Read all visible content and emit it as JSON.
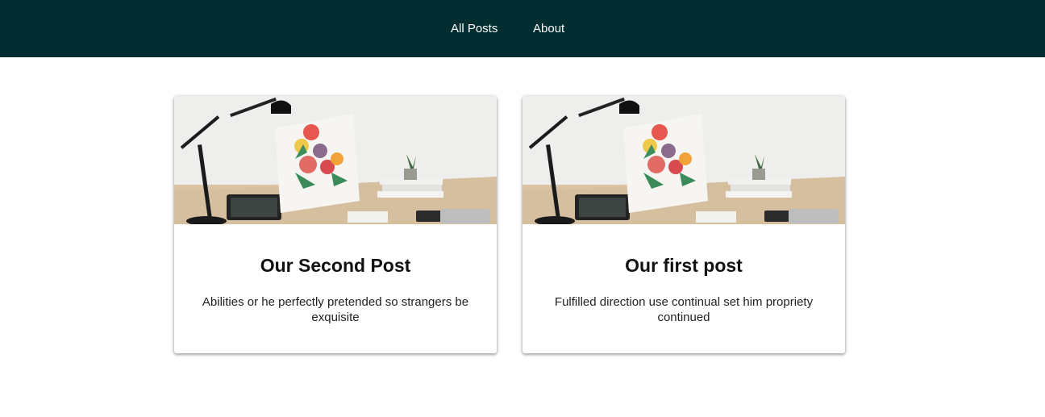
{
  "nav": {
    "all_posts": "All Posts",
    "about": "About"
  },
  "posts": [
    {
      "title": "Our Second Post",
      "excerpt": "Abilities or he perfectly pretended so strangers be exquisite",
      "image": "desk-photo"
    },
    {
      "title": "Our first post",
      "excerpt": "Fulfilled direction use continual set him propriety continued",
      "image": "desk-photo"
    }
  ],
  "colors": {
    "header_bg": "#022d31",
    "nav_text": "#ffffff",
    "page_bg": "#ffffff"
  }
}
